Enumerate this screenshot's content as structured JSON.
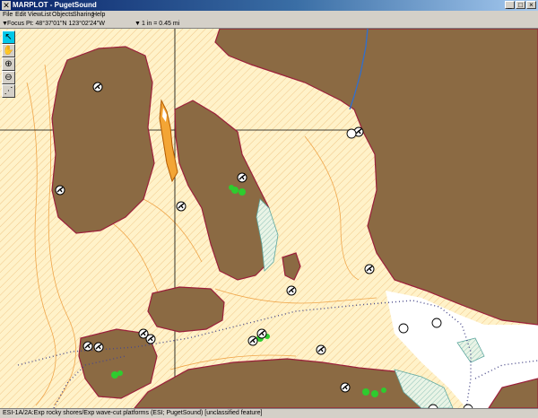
{
  "window": {
    "title": "MARPLOT - PugetSound",
    "app_icon": "map-app-icon"
  },
  "menubar": [
    {
      "label": "File",
      "name": "menu-file"
    },
    {
      "label": "Edit",
      "name": "menu-edit"
    },
    {
      "label": "View",
      "name": "menu-view"
    },
    {
      "label": "List",
      "name": "menu-list"
    },
    {
      "label": "Objects",
      "name": "menu-objects"
    },
    {
      "label": "Sharing",
      "name": "menu-sharing"
    },
    {
      "label": "Help",
      "name": "menu-help"
    }
  ],
  "infobar": {
    "focus": "Focus Pt: 48°37'01\"N 123°02'24\"W",
    "scale": "1 in = 0.45 mi"
  },
  "tools": [
    {
      "name": "arrow-tool",
      "glyph": "↖"
    },
    {
      "name": "hand-tool",
      "glyph": "✋"
    },
    {
      "name": "zoom-in-tool",
      "glyph": "⊕"
    },
    {
      "name": "zoom-out-tool",
      "glyph": "⊖"
    },
    {
      "name": "lasso-tool",
      "glyph": "⋰"
    }
  ],
  "map": {
    "land_color": "#8b6a43",
    "water_color": "#fff2c9",
    "deep_water_color": "#ffffff",
    "shoreline_color": "#9b1f3a",
    "ferry_route_color": "#4a4a8a",
    "eelgrass_color": "#2ecc2e"
  },
  "status": "ESI-1A/2A:Exp rocky shores/Exp wave-cut platforms (ESI; PugetSound) [unclassified feature]"
}
